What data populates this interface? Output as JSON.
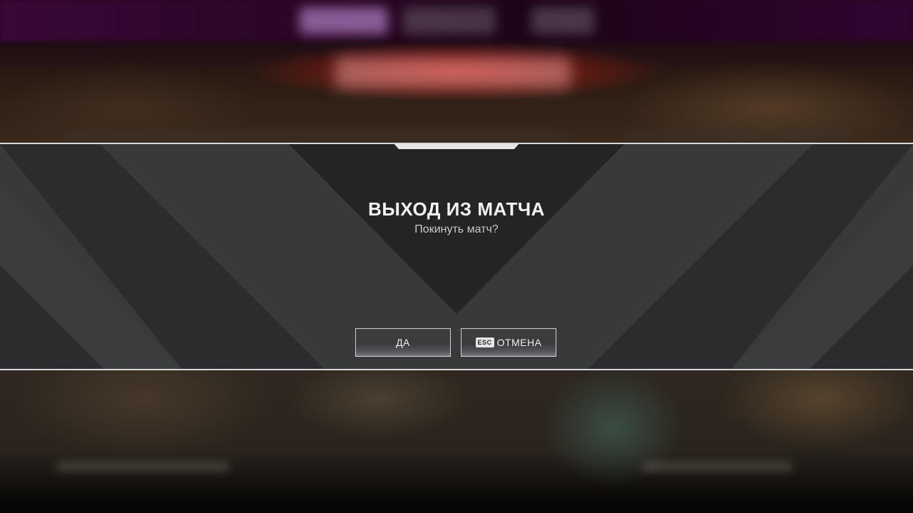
{
  "dialog": {
    "title": "ВЫХОД ИЗ МАТЧА",
    "subtitle": "Покинуть матч?",
    "confirm_label": "ДА",
    "cancel_label": "ОТМЕНА",
    "cancel_key_hint": "ESC"
  },
  "colors": {
    "panel": "#38393b",
    "chevron_dark": "#2a2b2d",
    "border": "#d9d9d9",
    "text": "#f2f2f2"
  },
  "icons": {
    "cancel_key": "esc-key-icon"
  }
}
